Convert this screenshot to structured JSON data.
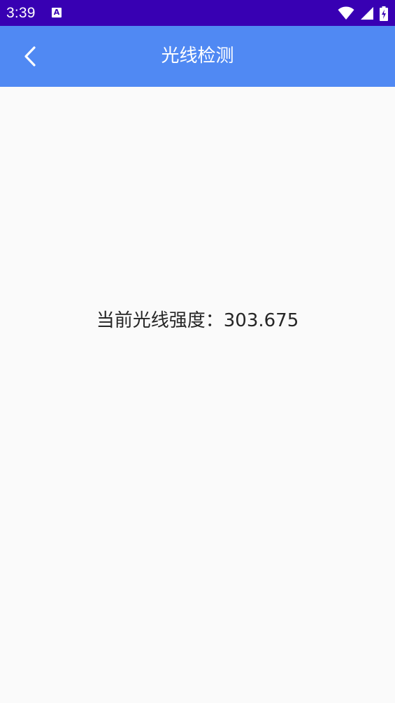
{
  "status_bar": {
    "time": "3:39",
    "notification_icon": "a-icon",
    "icons": [
      "wifi-icon",
      "cell-signal-icon",
      "battery-charging-icon"
    ]
  },
  "app_bar": {
    "back_icon": "chevron-left-icon",
    "title": "光线检测",
    "background_color": "#5089f3"
  },
  "main": {
    "reading_label": "当前光线强度：",
    "reading_value": "303.675"
  },
  "colors": {
    "status_bar": "#3800b3",
    "app_bar": "#5089f3",
    "background": "#fafafa",
    "text": "#262626"
  }
}
